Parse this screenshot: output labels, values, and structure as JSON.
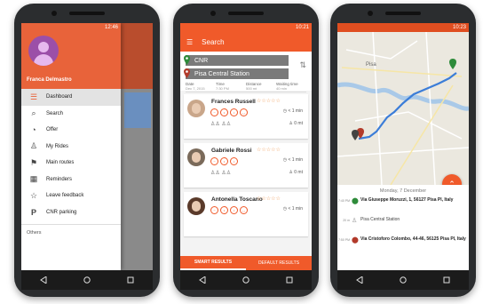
{
  "phone1": {
    "status_time": "12:46",
    "user_name": "Franca Delmastro",
    "menu": [
      {
        "label": "Dashboard",
        "icon": "list-icon",
        "active": true
      },
      {
        "label": "Search",
        "icon": "search-icon"
      },
      {
        "label": "Offer",
        "icon": "offer-icon"
      },
      {
        "label": "My Rides",
        "icon": "rides-icon"
      },
      {
        "label": "Main routes",
        "icon": "signpost-icon"
      },
      {
        "label": "Reminders",
        "icon": "calendar-icon"
      },
      {
        "label": "Leave feedback",
        "icon": "star-icon"
      },
      {
        "label": "CNR parking",
        "icon": "parking-icon"
      }
    ],
    "others_label": "Others"
  },
  "phone2": {
    "status_time": "10:21",
    "title": "Search",
    "origin": "CNR",
    "destination": "Pisa Central Station",
    "columns": [
      "Date",
      "Time",
      "Distance",
      "Waiting time"
    ],
    "column_values": [
      "Dec 7, 2015",
      "7:30 PM",
      "500 mt",
      "40 min"
    ],
    "results": [
      {
        "name": "Frances Russell",
        "stars": "☆☆☆☆☆",
        "time": "< 1 min",
        "distance": "0 mt"
      },
      {
        "name": "Gabriele Rossi",
        "stars": "☆☆☆☆☆",
        "time": "< 1 min",
        "distance": "0 mt"
      },
      {
        "name": "Antonella Toscano",
        "stars": "☆☆☆☆☆",
        "time": "< 1 min",
        "distance": ""
      }
    ],
    "tab_smart": "SMART RESULTS",
    "tab_default": "DEFAULT RESULTS"
  },
  "phone3": {
    "status_time": "10:23",
    "map_city": "Pisa",
    "date": "Monday, 7 December",
    "stops": [
      {
        "time": "7:40 PM",
        "address": "Via Giuseppe Moruzzi, 1, 56127 Pisa PI, Italy",
        "color": "#3a8a3a"
      },
      {
        "time": "20 m",
        "address": "Pisa Central Station",
        "color": "#999999"
      },
      {
        "time": "7:50 PM",
        "address": "Via Cristoforo Colombo, 44-46, 56125 Pisa PI, Italy",
        "color": "#b23a2a"
      }
    ]
  },
  "colors": {
    "accent": "#f05a2a",
    "route": "#3b7dd8"
  }
}
